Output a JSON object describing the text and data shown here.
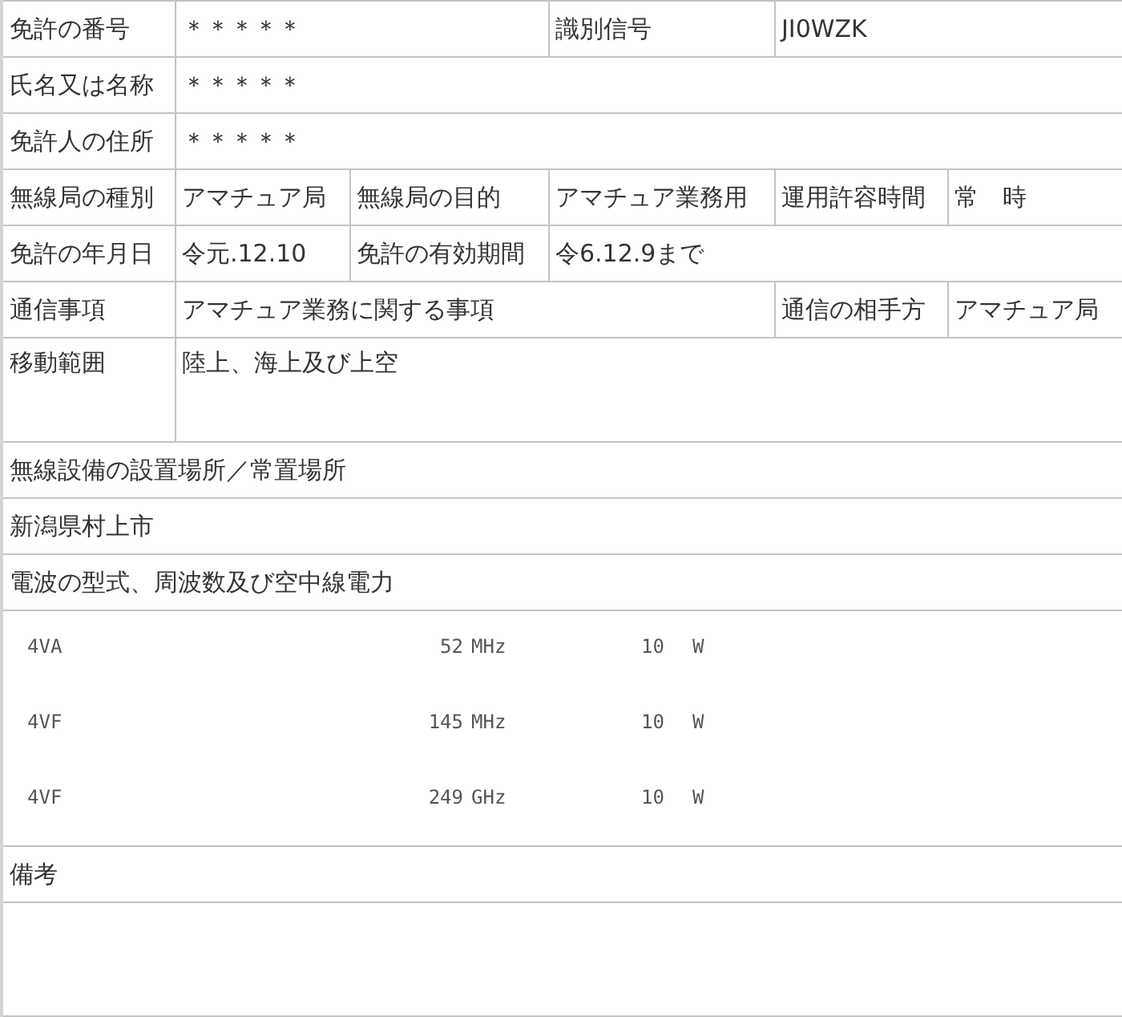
{
  "rows": [
    {
      "kind": "text",
      "cells": [
        {
          "text": "免許の番号"
        },
        {
          "text": "＊＊＊＊＊"
        },
        {
          "text": "識別信号"
        },
        {
          "text": "JI0WZK"
        }
      ]
    },
    {
      "kind": "text",
      "cells": [
        {
          "text": "氏名又は名称"
        },
        {
          "text": "＊＊＊＊＊"
        }
      ]
    },
    {
      "kind": "text",
      "cells": [
        {
          "text": "免許人の住所"
        },
        {
          "text": "＊＊＊＊＊"
        }
      ]
    },
    {
      "kind": "text",
      "cells": [
        {
          "text": "無線局の種別"
        },
        {
          "text": "アマチュア局"
        },
        {
          "text": "無線局の目的"
        },
        {
          "text": "アマチュア業務用"
        },
        {
          "text": "運用許容時間"
        },
        {
          "text": "常　時"
        }
      ]
    },
    {
      "kind": "text",
      "cells": [
        {
          "text": "免許の年月日"
        },
        {
          "text": "令元.12.10"
        },
        {
          "text": "免許の有効期間"
        },
        {
          "text": "令6.12.9まで"
        }
      ]
    },
    {
      "kind": "text",
      "cells": [
        {
          "text": "通信事項"
        },
        {
          "text": "アマチュア業務に関する事項"
        },
        {
          "text": "通信の相手方"
        },
        {
          "text": "アマチュア局"
        }
      ]
    },
    {
      "kind": "tall_text",
      "cells": [
        {
          "text": "移動範囲"
        },
        {
          "text": "陸上、海上及び上空"
        }
      ]
    },
    {
      "kind": "text",
      "cells": [
        {
          "text": "無線設備の設置場所／常置場所"
        }
      ]
    },
    {
      "kind": "text",
      "cells": [
        {
          "text": "新潟県村上市"
        }
      ]
    },
    {
      "kind": "text",
      "cells": [
        {
          "text": "電波の型式、周波数及び空中線電力"
        }
      ]
    },
    {
      "kind": "emissions",
      "emissions": [
        {
          "type": "4VA",
          "frequency": "52",
          "unit": "MHz",
          "power": "10",
          "power_unit": "W"
        },
        {
          "type": "4VF",
          "frequency": "145",
          "unit": "MHz",
          "power": "10",
          "power_unit": "W"
        },
        {
          "type": "4VF",
          "frequency": "249",
          "unit": "GHz",
          "power": "10",
          "power_unit": "W"
        }
      ]
    },
    {
      "kind": "text",
      "cells": [
        {
          "text": "備考"
        }
      ]
    }
  ]
}
